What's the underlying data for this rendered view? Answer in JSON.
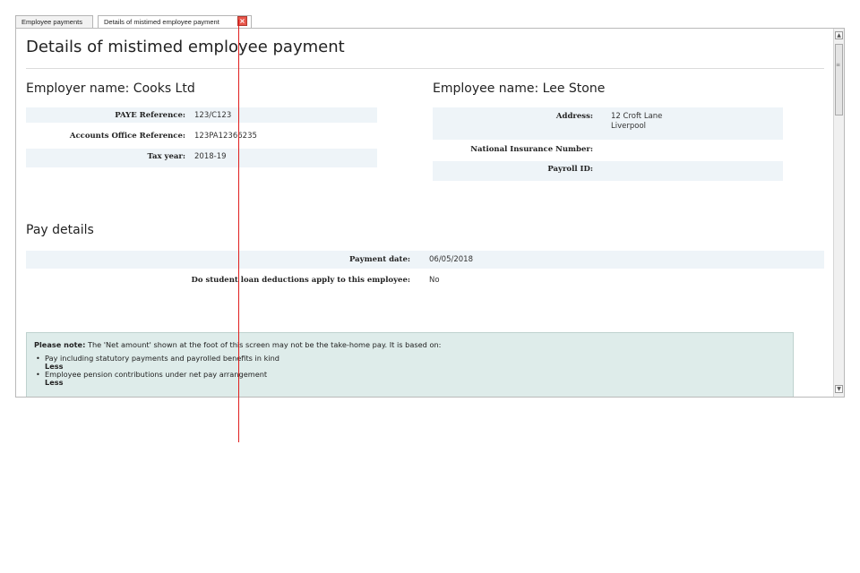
{
  "tabs": [
    {
      "label": "Employee payments",
      "active": false
    },
    {
      "label": "Details of mistimed employee payment",
      "active": true
    }
  ],
  "page_title": "Details of mistimed employee payment",
  "employer": {
    "heading": "Employer name: Cooks Ltd",
    "fields": [
      {
        "label": "PAYE Reference:",
        "value": "123/C123"
      },
      {
        "label": "Accounts Office Reference:",
        "value": "123PA12366235"
      },
      {
        "label": "Tax year:",
        "value": "2018-19"
      }
    ]
  },
  "employee": {
    "heading": "Employee name: Lee Stone",
    "address_label": "Address:",
    "address_line1": "12 Croft Lane",
    "address_line2": "Liverpool",
    "ni_label": "National Insurance Number:",
    "ni_value": "",
    "payroll_label": "Payroll ID:",
    "payroll_value": ""
  },
  "pay_details": {
    "heading": "Pay details",
    "payment_date_label": "Payment date:",
    "payment_date_value": "06/05/2018",
    "student_loan_label": "Do student loan deductions apply to this employee:",
    "student_loan_value": "No"
  },
  "note": {
    "prefix": "Please note:",
    "text": " The 'Net amount' shown at the foot of this screen may not be the take-home pay. It is based on:",
    "items": [
      {
        "text": "Pay including statutory payments and payrolled benefits in kind",
        "suffix": "Less"
      },
      {
        "text": "Employee pension contributions under net pay arrangement",
        "suffix": "Less"
      }
    ]
  },
  "colors": {
    "annotation_line": "#e01e1e",
    "note_bg": "#deecea",
    "row_shade": "#eef4f8"
  }
}
